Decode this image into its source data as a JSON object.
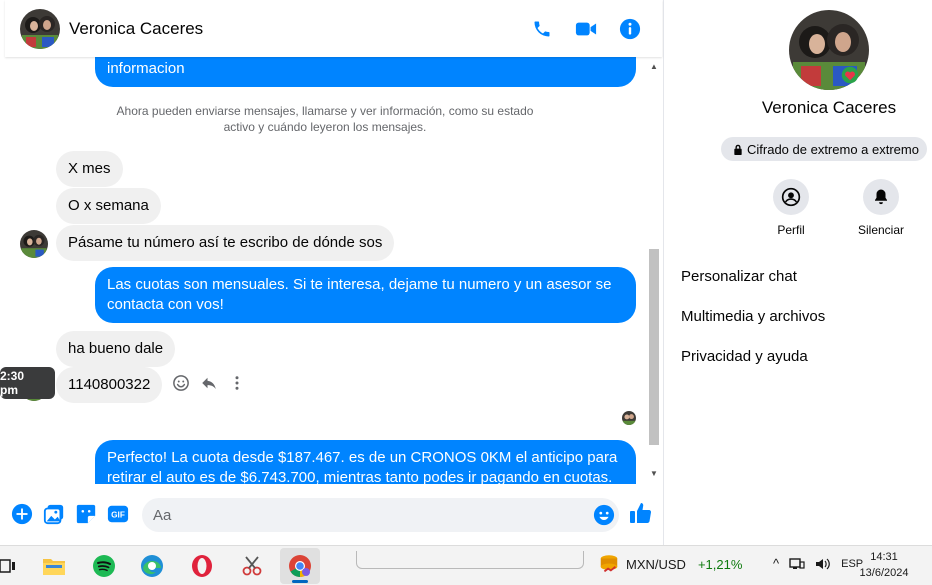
{
  "header": {
    "contact_name": "Veronica Caceres"
  },
  "messages": {
    "top_partial": "informacion",
    "system_note": "Ahora pueden enviarse mensajes, llamarse y ver información, como su estado activo y cuándo leyeron los mensajes.",
    "m1": "X mes",
    "m2": "O x semana",
    "m3": "Pásame tu número así te escribo de dónde sos",
    "m4": "Las cuotas son mensuales. Si te interesa, dejame tu numero y un asesor se contacta con vos!",
    "m5": "ha bueno dale",
    "m6": "1140800322",
    "m7": "Perfecto! La cuota desde $187.467. es de un CRONOS 0KM el anticipo para retirar el auto es de $6.743.700, mientras tanto podes ir pagando en cuotas.",
    "tooltip_time": "2:30 pm"
  },
  "composer": {
    "placeholder": "Aa"
  },
  "side": {
    "name": "Veronica Caceres",
    "encryption": "Cifrado de extremo a extremo",
    "action_profile": "Perfil",
    "action_mute": "Silenciar",
    "menu": [
      "Personalizar chat",
      "Multimedia y archivos",
      "Privacidad y ayuda"
    ]
  },
  "taskbar": {
    "ticker_symbol": "MXN/USD",
    "ticker_change": "+1,21%",
    "language": "ESP",
    "time": "14:31",
    "date": "13/6/2024"
  },
  "colors": {
    "accent": "#0084ff",
    "incoming_bubble": "#f0f0f0",
    "ticker_up": "#0f7b0f"
  }
}
